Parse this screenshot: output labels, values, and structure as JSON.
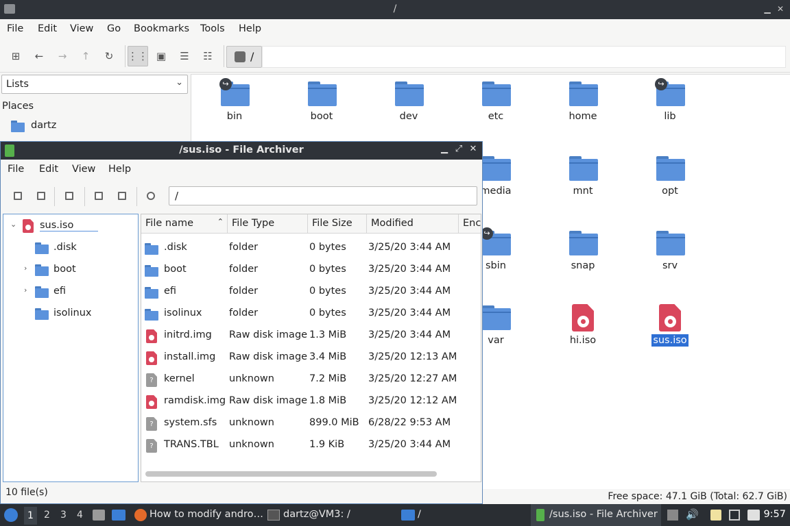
{
  "file_manager": {
    "title": "/",
    "menu": [
      "File",
      "Edit",
      "View",
      "Go",
      "Bookmarks",
      "Tools",
      "Help"
    ],
    "path": "/",
    "side_select": "Lists",
    "places_title": "Places",
    "places": [
      {
        "label": "dartz",
        "icon": "home-folder-icon"
      }
    ],
    "items": [
      {
        "label": "bin",
        "type": "folder",
        "link": true
      },
      {
        "label": "boot",
        "type": "folder",
        "link": false
      },
      {
        "label": "dev",
        "type": "folder",
        "link": false
      },
      {
        "label": "etc",
        "type": "folder",
        "link": false
      },
      {
        "label": "home",
        "type": "folder",
        "link": false
      },
      {
        "label": "lib",
        "type": "folder",
        "link": true
      },
      {
        "label": "media",
        "type": "folder",
        "link": false
      },
      {
        "label": "mnt",
        "type": "folder",
        "link": false
      },
      {
        "label": "opt",
        "type": "folder",
        "link": false
      },
      {
        "label": "sbin",
        "type": "folder",
        "link": true
      },
      {
        "label": "snap",
        "type": "folder",
        "link": false
      },
      {
        "label": "srv",
        "type": "folder",
        "link": false
      },
      {
        "label": "var",
        "type": "folder",
        "link": false
      },
      {
        "label": "hi.iso",
        "type": "iso",
        "link": false
      },
      {
        "label": "sus.iso",
        "type": "iso",
        "link": false,
        "selected": true
      }
    ],
    "status": "Free space: 47.1 GiB (Total: 62.7 GiB)"
  },
  "archiver": {
    "title": "/sus.iso - File Archiver",
    "menu": [
      "File",
      "Edit",
      "View",
      "Help"
    ],
    "location": "/",
    "tree": [
      {
        "label": "sus.iso",
        "icon": "iso",
        "level": 0,
        "expander": "expanded"
      },
      {
        "label": ".disk",
        "icon": "folder",
        "level": 1,
        "expander": ""
      },
      {
        "label": "boot",
        "icon": "folder",
        "level": 1,
        "expander": "collapsed"
      },
      {
        "label": "efi",
        "icon": "folder",
        "level": 1,
        "expander": "collapsed"
      },
      {
        "label": "isolinux",
        "icon": "folder",
        "level": 1,
        "expander": ""
      }
    ],
    "columns": [
      "File name",
      "File Type",
      "File Size",
      "Modified",
      "Encr"
    ],
    "files": [
      {
        "name": ".disk",
        "type": "folder",
        "size": "0 bytes",
        "modified": "3/25/20 3:44 AM",
        "icon": "folder"
      },
      {
        "name": "boot",
        "type": "folder",
        "size": "0 bytes",
        "modified": "3/25/20 3:44 AM",
        "icon": "folder"
      },
      {
        "name": "efi",
        "type": "folder",
        "size": "0 bytes",
        "modified": "3/25/20 3:44 AM",
        "icon": "folder"
      },
      {
        "name": "isolinux",
        "type": "folder",
        "size": "0 bytes",
        "modified": "3/25/20 3:44 AM",
        "icon": "folder"
      },
      {
        "name": "initrd.img",
        "type": "Raw disk image",
        "size": "1.3 MiB",
        "modified": "3/25/20 3:44 AM",
        "icon": "disk-image"
      },
      {
        "name": "install.img",
        "type": "Raw disk image",
        "size": "3.4 MiB",
        "modified": "3/25/20 12:13 AM",
        "icon": "disk-image"
      },
      {
        "name": "kernel",
        "type": "unknown",
        "size": "7.2 MiB",
        "modified": "3/25/20 12:27 AM",
        "icon": "unknown"
      },
      {
        "name": "ramdisk.img",
        "type": "Raw disk image",
        "size": "1.8 MiB",
        "modified": "3/25/20 12:12 AM",
        "icon": "disk-image"
      },
      {
        "name": "system.sfs",
        "type": "unknown",
        "size": "899.0 MiB",
        "modified": "6/28/22 9:53 AM",
        "icon": "unknown"
      },
      {
        "name": "TRANS.TBL",
        "type": "unknown",
        "size": "1.9 KiB",
        "modified": "3/25/20 3:44 AM",
        "icon": "unknown"
      }
    ],
    "status": "10 file(s)"
  },
  "taskbar": {
    "workspaces": [
      "1",
      "2",
      "3",
      "4"
    ],
    "active_workspace": "1",
    "tasks": [
      {
        "label": "How to modify andro…",
        "icon": "firefox-icon"
      },
      {
        "label": "dartz@VM3: /",
        "icon": "terminal-icon"
      },
      {
        "label": "/",
        "icon": "folder-icon"
      },
      {
        "label": "/sus.iso - File Archiver",
        "icon": "archiver-icon",
        "active": true
      }
    ],
    "clock": "9:57"
  },
  "colors": {
    "folder": "#5b92dc",
    "iso": "#d9465c",
    "selection": "#2e6fd4",
    "titlebar": "#2f3339",
    "taskbar": "#2a2e33"
  }
}
